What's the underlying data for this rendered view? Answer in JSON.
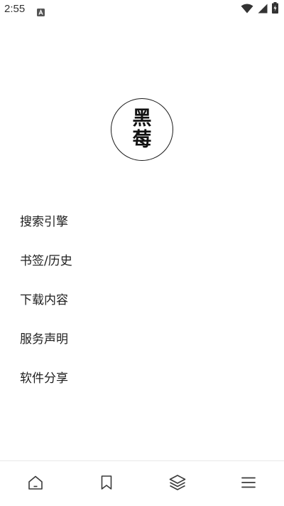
{
  "status_bar": {
    "time": "2:55",
    "icons": [
      "notification-a-icon",
      "wifi-icon",
      "cellular-signal-icon",
      "battery-charging-icon"
    ]
  },
  "logo": {
    "char_top": "黑",
    "char_bottom": "莓"
  },
  "menu": {
    "items": [
      {
        "label": "搜索引擎"
      },
      {
        "label": "书签/历史"
      },
      {
        "label": "下载内容"
      },
      {
        "label": "服务声明"
      },
      {
        "label": "软件分享"
      }
    ]
  },
  "bottom_nav": {
    "items": [
      "home-icon",
      "bookmark-icon",
      "layers-icon",
      "menu-icon"
    ]
  },
  "colors": {
    "text": "#1f1f1f",
    "background": "#ffffff",
    "icon": "#3a3a3a"
  }
}
